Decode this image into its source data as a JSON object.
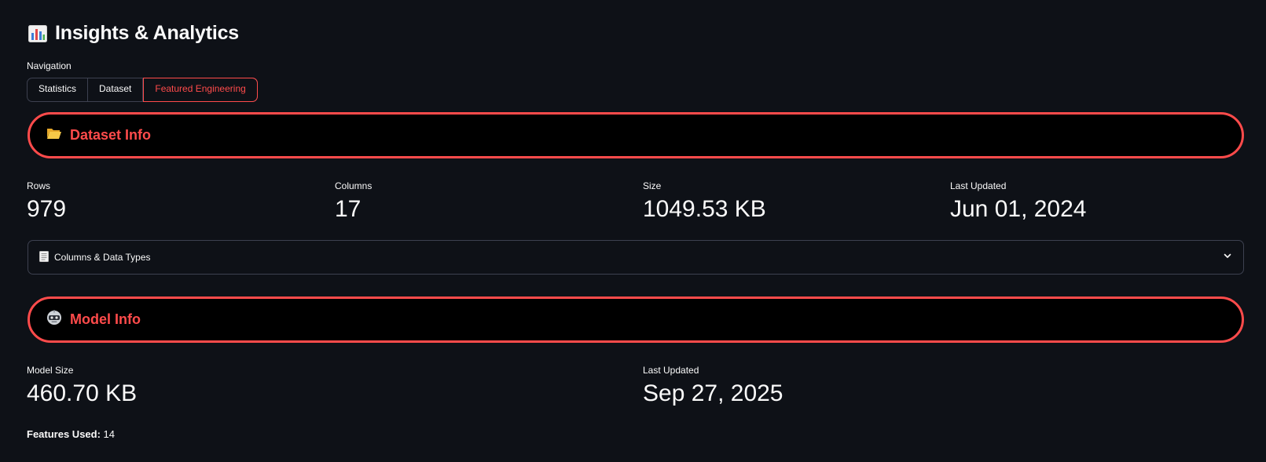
{
  "page": {
    "title": "Insights & Analytics",
    "title_icon": "bar-chart-icon"
  },
  "navigation": {
    "label": "Navigation",
    "tabs": [
      {
        "label": "Statistics",
        "selected": false
      },
      {
        "label": "Dataset",
        "selected": false
      },
      {
        "label": "Featured Engineering",
        "selected": true
      }
    ]
  },
  "dataset_info": {
    "title": "Dataset Info",
    "icon": "open-folder-icon",
    "metrics": [
      {
        "label": "Rows",
        "value": "979"
      },
      {
        "label": "Columns",
        "value": "17"
      },
      {
        "label": "Size",
        "value": "1049.53 KB"
      },
      {
        "label": "Last Updated",
        "value": "Jun 01, 2024"
      }
    ],
    "expander": {
      "label": "Columns & Data Types",
      "icon": "page-icon",
      "expanded": false
    }
  },
  "model_info": {
    "title": "Model Info",
    "icon": "robot-icon",
    "metrics": [
      {
        "label": "Model Size",
        "value": "460.70 KB"
      },
      {
        "label": "Last Updated",
        "value": "Sep 27, 2025"
      }
    ],
    "features_label": "Features Used:",
    "features_value": "14"
  },
  "colors": {
    "background": "#0e1117",
    "accent": "#ff4b4b",
    "text": "#fafafa",
    "border": "#3d4150"
  }
}
